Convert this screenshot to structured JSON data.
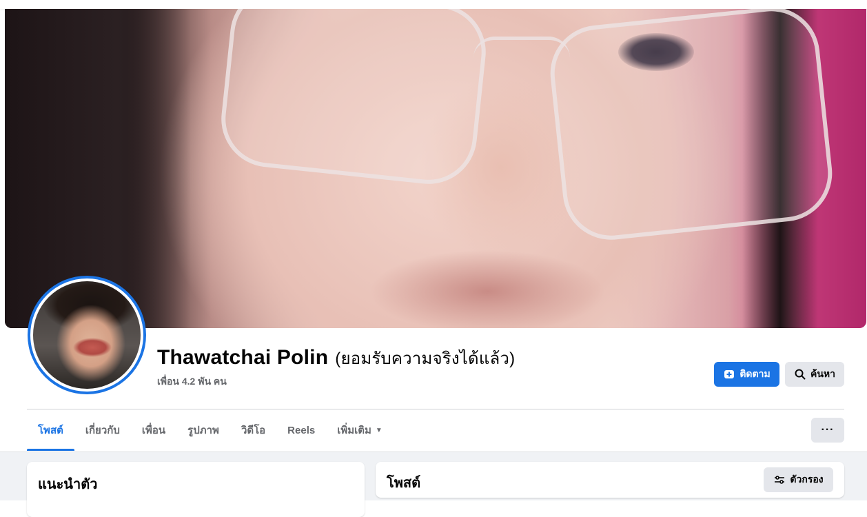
{
  "profile": {
    "name": "Thawatchai Polin",
    "alternate_name": "(ยอมรับความจริงได้แล้ว)",
    "friends_count": "เพื่อน 4.2 พัน คน"
  },
  "actions": {
    "follow_label": "ติดตาม",
    "follow_icon": "add-friend-icon",
    "search_label": "ค้นหา",
    "search_icon": "search-icon"
  },
  "tabs": [
    {
      "label": "โพสต์",
      "active": true
    },
    {
      "label": "เกี่ยวกับ",
      "active": false
    },
    {
      "label": "เพื่อน",
      "active": false
    },
    {
      "label": "รูปภาพ",
      "active": false
    },
    {
      "label": "วิดีโอ",
      "active": false
    },
    {
      "label": "Reels",
      "active": false
    },
    {
      "label": "เพิ่มเติม",
      "active": false,
      "icon": "caret-down-icon"
    }
  ],
  "more_menu_label": "···",
  "intro_card": {
    "title": "แนะนำตัว"
  },
  "posts_card": {
    "title": "โพสต์",
    "filter_label": "ตัวกรอง",
    "filter_icon": "filter-icon"
  },
  "colors": {
    "accent": "#1b74e4",
    "secondary_button": "#e4e6eb",
    "muted_text": "#65676b",
    "page_bg": "#f0f2f5"
  }
}
